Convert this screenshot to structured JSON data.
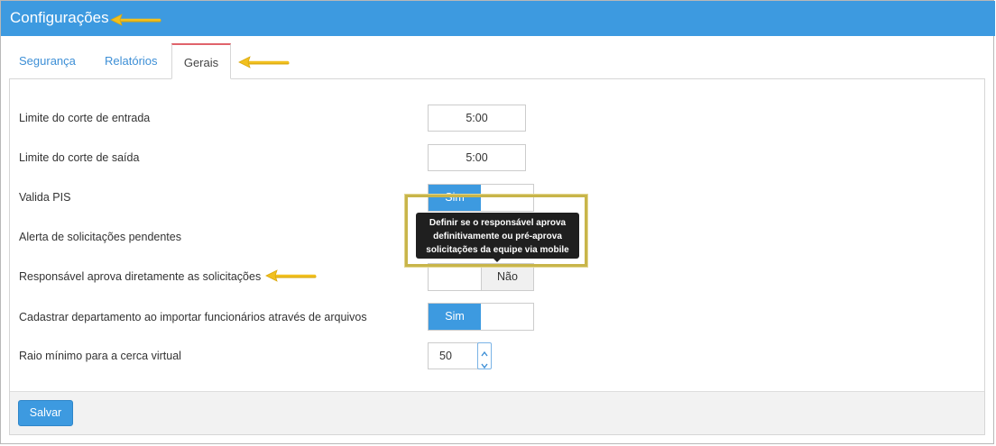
{
  "header": {
    "title": "Configurações"
  },
  "tabs": [
    {
      "label": "Segurança",
      "active": false
    },
    {
      "label": "Relatórios",
      "active": false
    },
    {
      "label": "Gerais",
      "active": true
    }
  ],
  "settings": {
    "corte_entrada": {
      "label": "Limite do corte de entrada",
      "value": "5:00"
    },
    "corte_saida": {
      "label": "Limite do corte de saída",
      "value": "5:00"
    },
    "valida_pis": {
      "label": "Valida PIS",
      "on_label": "Sim",
      "selected": "Sim"
    },
    "alerta_pendentes": {
      "label": "Alerta de solicitações pendentes"
    },
    "responsavel_aprova": {
      "label": "Responsável aprova diretamente as solicitações",
      "off_label": "Não",
      "selected": "Não"
    },
    "cadastrar_departamento": {
      "label": "Cadastrar departamento ao importar funcionários através de arquivos",
      "on_label": "Sim",
      "selected": "Sim"
    },
    "raio_minimo": {
      "label": "Raio mínimo para a cerca virtual",
      "value": "50"
    }
  },
  "tooltip": {
    "lines": [
      "Definir se o responsável aprova",
      "definitivamente ou pré-aprova",
      "solicitações da equipe via mobile"
    ]
  },
  "footer": {
    "save_label": "Salvar"
  },
  "colors": {
    "primary": "#3d9ae0",
    "active_tab_border": "#e0636b",
    "annotation_arrow": "#f2c01e",
    "annotation_box": "#c8b54a",
    "tooltip_bg": "#1f1f1f"
  },
  "icons": {
    "spin_up": "chevron-up-icon",
    "spin_down": "chevron-down-icon",
    "annotation": "arrow-left-icon"
  }
}
